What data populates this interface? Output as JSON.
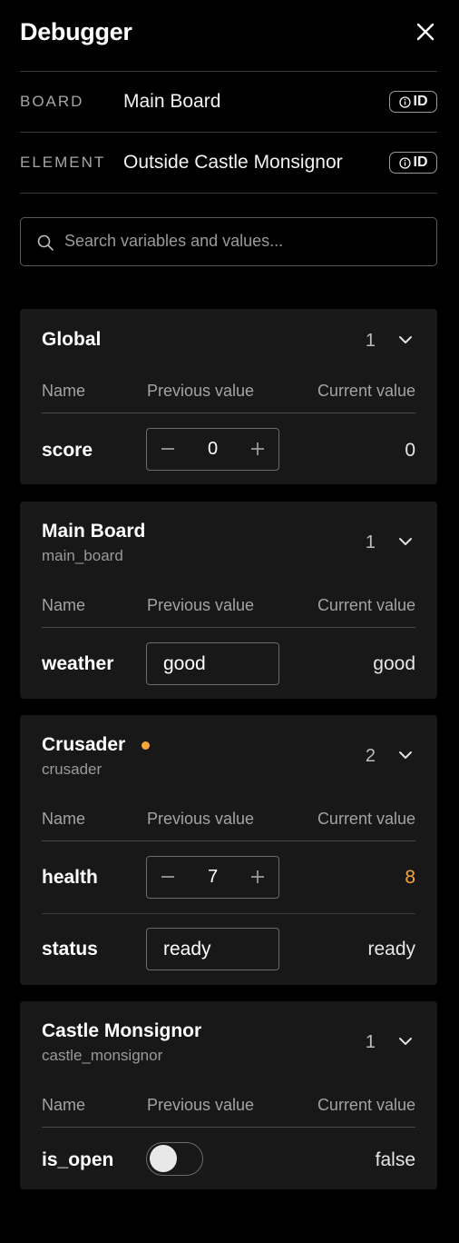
{
  "header": {
    "title": "Debugger",
    "close_icon": "close-icon"
  },
  "meta": {
    "board_key": "BOARD",
    "board_value": "Main Board",
    "element_key": "ELEMENT",
    "element_value": "Outside Castle Monsignor",
    "id_label": "ID"
  },
  "search": {
    "placeholder": "Search variables and values...",
    "value": ""
  },
  "columns": {
    "name": "Name",
    "previous": "Previous value",
    "current": "Current value"
  },
  "colors": {
    "background": "#000000",
    "card": "#181818",
    "changed": "#f5a53a",
    "muted": "#9a9a9a"
  },
  "groups": [
    {
      "title": "Global",
      "count": "1",
      "variables": [
        {
          "name": "score",
          "control": "stepper",
          "previous": "0",
          "current": "0",
          "changed": false
        }
      ]
    },
    {
      "title": "Main Board",
      "subtitle": "main_board",
      "count": "1",
      "variables": [
        {
          "name": "weather",
          "control": "text",
          "previous": "good",
          "current": "good",
          "changed": false
        }
      ]
    },
    {
      "title": "Crusader",
      "subtitle": "crusader",
      "count": "2",
      "has_changes": true,
      "variables": [
        {
          "name": "health",
          "control": "stepper",
          "previous": "7",
          "current": "8",
          "changed": true
        },
        {
          "name": "status",
          "control": "text",
          "previous": "ready",
          "current": "ready",
          "changed": false
        }
      ]
    },
    {
      "title": "Castle Monsignor",
      "subtitle": "castle_monsignor",
      "count": "1",
      "variables": [
        {
          "name": "is_open",
          "control": "toggle",
          "previous_on": false,
          "current": "false",
          "changed": false
        }
      ]
    }
  ]
}
